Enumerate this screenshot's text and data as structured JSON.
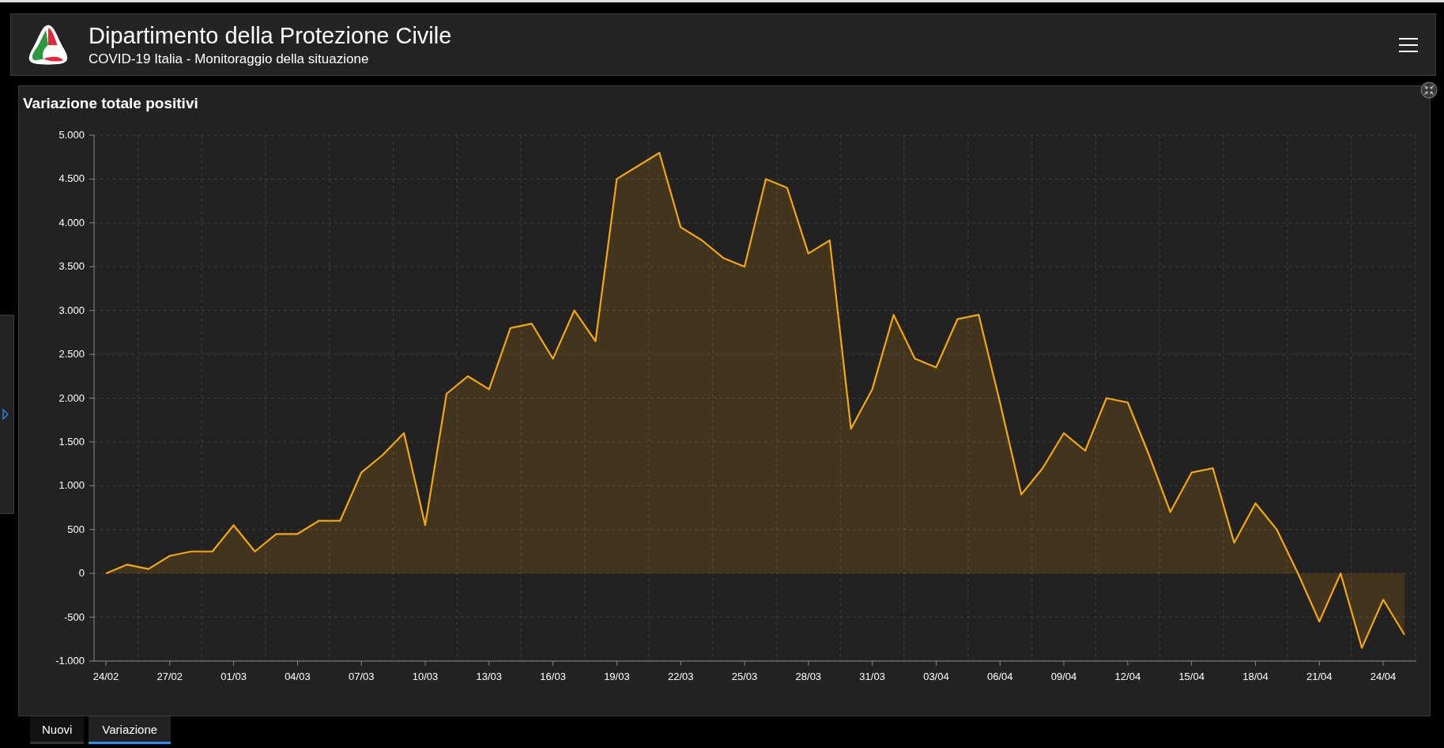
{
  "header": {
    "title": "Dipartimento della Protezione Civile",
    "subtitle": "COVID-19 Italia - Monitoraggio della situazione"
  },
  "panel": {
    "title": "Variazione totale positivi",
    "chart_data": {
      "type": "area",
      "grid": true,
      "categories": [
        "24/02",
        null,
        null,
        "27/02",
        null,
        null,
        "01/03",
        null,
        null,
        "04/03",
        null,
        null,
        "07/03",
        null,
        null,
        "10/03",
        null,
        null,
        "13/03",
        null,
        null,
        "16/03",
        null,
        null,
        "19/03",
        null,
        null,
        "22/03",
        null,
        null,
        "25/03",
        null,
        null,
        "28/03",
        null,
        null,
        "31/03",
        null,
        null,
        "03/04",
        null,
        null,
        "06/04",
        null,
        null,
        "09/04",
        null,
        null,
        "12/04",
        null,
        null,
        "15/04",
        null,
        null,
        "18/04",
        null,
        null,
        "21/04",
        null,
        null,
        "24/04",
        null
      ],
      "series": [
        {
          "color": "#f5a70f",
          "values": [
            0,
            100,
            50,
            200,
            250,
            250,
            550,
            250,
            450,
            450,
            600,
            600,
            1150,
            1350,
            1600,
            550,
            2050,
            2250,
            2100,
            2800,
            2850,
            2450,
            3000,
            2650,
            4500,
            4650,
            4800,
            3950,
            3800,
            3600,
            3500,
            4500,
            4400,
            3650,
            3800,
            1650,
            2100,
            2950,
            2450,
            2350,
            2900,
            2950,
            1950,
            900,
            1200,
            1600,
            1400,
            2000,
            1950,
            1350,
            700,
            1150,
            1200,
            350,
            800,
            500,
            0,
            -550,
            0,
            -850,
            -300,
            -700
          ]
        }
      ],
      "ylim": [
        -1000,
        5000
      ],
      "yticks": [
        {
          "value": -1000,
          "label": "-1.000"
        },
        {
          "value": -500,
          "label": "-500"
        },
        {
          "value": 0,
          "label": "0"
        },
        {
          "value": 500,
          "label": "500"
        },
        {
          "value": 1000,
          "label": "1.000"
        },
        {
          "value": 1500,
          "label": "1.500"
        },
        {
          "value": 2000,
          "label": "2.000"
        },
        {
          "value": 2500,
          "label": "2.500"
        },
        {
          "value": 3000,
          "label": "3.000"
        },
        {
          "value": 3500,
          "label": "3.500"
        },
        {
          "value": 4000,
          "label": "4.000"
        },
        {
          "value": 4500,
          "label": "4.500"
        },
        {
          "value": 5000,
          "label": "5.000"
        }
      ]
    }
  },
  "tabs": [
    {
      "label": "Nuovi",
      "selected": false
    },
    {
      "label": "Variazione",
      "selected": true
    }
  ]
}
